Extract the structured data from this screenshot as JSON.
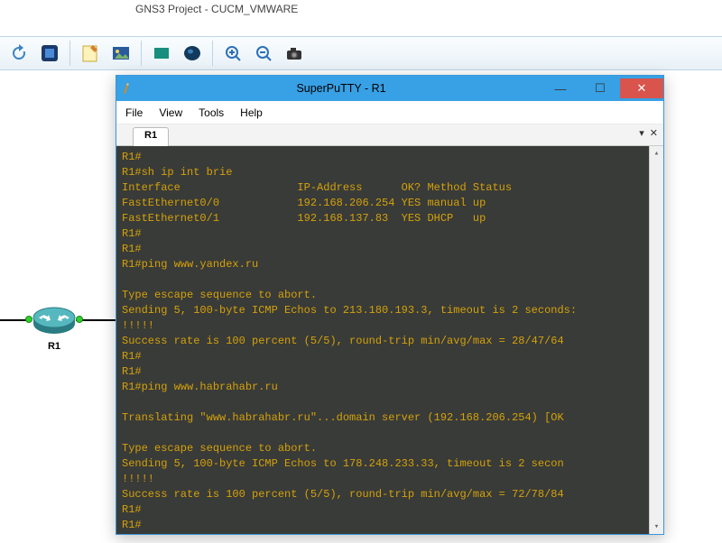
{
  "gns3": {
    "title": "GNS3 Project - CUCM_VMWARE"
  },
  "router": {
    "label": "R1"
  },
  "window": {
    "title": "SuperPuTTY - R1",
    "menu": [
      "File",
      "View",
      "Tools",
      "Help"
    ],
    "tab": "R1"
  },
  "terminal": {
    "lines": [
      "R1#",
      "R1#sh ip int brie",
      "Interface                  IP-Address      OK? Method Status",
      "FastEthernet0/0            192.168.206.254 YES manual up",
      "FastEthernet0/1            192.168.137.83  YES DHCP   up",
      "R1#",
      "R1#",
      "R1#ping www.yandex.ru",
      "",
      "Type escape sequence to abort.",
      "Sending 5, 100-byte ICMP Echos to 213.180.193.3, timeout is 2 seconds:",
      "!!!!!",
      "Success rate is 100 percent (5/5), round-trip min/avg/max = 28/47/64",
      "R1#",
      "R1#",
      "R1#ping www.habrahabr.ru",
      "",
      "Translating \"www.habrahabr.ru\"...domain server (192.168.206.254) [OK",
      "",
      "Type escape sequence to abort.",
      "Sending 5, 100-byte ICMP Echos to 178.248.233.33, timeout is 2 secon",
      "!!!!!",
      "Success rate is 100 percent (5/5), round-trip min/avg/max = 72/78/84",
      "R1#",
      "R1#"
    ]
  }
}
